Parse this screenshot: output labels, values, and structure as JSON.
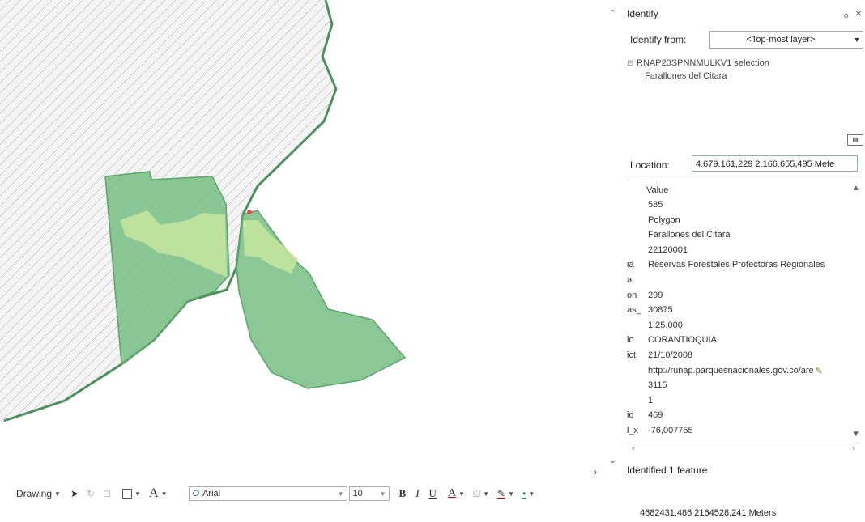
{
  "map": {
    "colors": {
      "hatch_bg": "#f4f4f4",
      "hatch_line": "#b8b8b8",
      "coast": "#4e8f5e",
      "polygon_fill": "#7fc28a",
      "polygon_stroke": "#5aa56a",
      "highlight_fill": "#c4e6a0",
      "marker": "#e05050"
    },
    "scroll_up_icon": "chevron-up-icon",
    "scroll_down_icon": "chevron-down-icon",
    "expand_icon": "chevron-right-icon"
  },
  "identify": {
    "title": "Identify",
    "pin_icon": "pin-icon",
    "close_icon": "close-icon",
    "identify_from_label": "Identify from:",
    "identify_from_value": "<Top-most layer>",
    "tree": {
      "layer": "RNAP20SPNNMULKV1 selection",
      "feature": "Farallones del Citara"
    },
    "location_label": "Location:",
    "location_value": "4.679.161,229  2.166.655,495 Mete",
    "grid_header": "Value",
    "rows": [
      {
        "field": "",
        "value": "585"
      },
      {
        "field": "",
        "value": "Polygon"
      },
      {
        "field": "",
        "value": "Farallones del Citara"
      },
      {
        "field": "",
        "value": "22120001"
      },
      {
        "field": "ia",
        "value": "Reservas Forestales Protectoras Regionales"
      },
      {
        "field": "a",
        "value": ""
      },
      {
        "field": "on",
        "value": "299"
      },
      {
        "field": "as_",
        "value": "30875"
      },
      {
        "field": "",
        "value": "1:25.000"
      },
      {
        "field": "io",
        "value": "CORANTIOQUIA"
      },
      {
        "field": "ict",
        "value": "21/10/2008"
      },
      {
        "field": "",
        "value": "http://runap.parquesnacionales.gov.co/are"
      },
      {
        "field": "",
        "value": "3115"
      },
      {
        "field": "",
        "value": "1"
      },
      {
        "field": "id",
        "value": "469"
      },
      {
        "field": "l_x",
        "value": "-76,007755"
      }
    ],
    "status": "Identified 1 feature"
  },
  "toolbar": {
    "drawing_label": "Drawing",
    "font_name": "Arial",
    "font_size": "10",
    "bold": "B",
    "italic": "I",
    "underline": "U",
    "text_a": "A"
  },
  "status_bar": {
    "coordinates": "4682431,486  2164528,241 Meters"
  }
}
